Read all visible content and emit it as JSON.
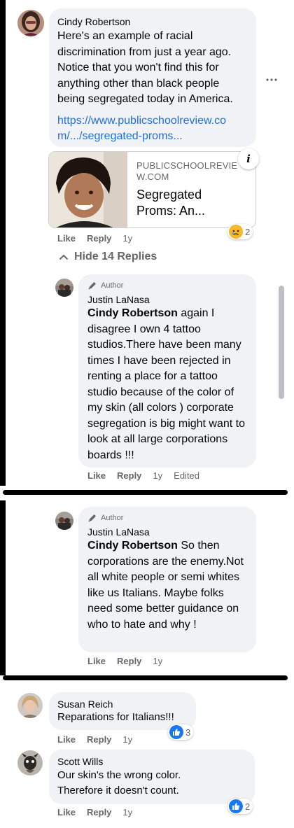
{
  "comment1": {
    "name": "Cindy Robertson",
    "text": "Here's an example of racial discrimination from just a year ago. Notice that you won't find this for anything other than black people being segregated today in America.",
    "link_line1": "https://www.publicschoolreview.co",
    "link_line2": "m/.../segregated-proms...",
    "preview_domain": "PUBLICSCHOOLREVIEW.COM",
    "preview_domain_line1": "PUBLICSCHOOLREVIE",
    "preview_domain_line2": "W.COM",
    "preview_title_line1": "Segregated",
    "preview_title_line2": "Proms: An...",
    "like": "Like",
    "reply": "Reply",
    "time": "1y",
    "reaction_count": "2",
    "more_icon": "more-horizontal-icon",
    "info_icon": "info-icon"
  },
  "hide_replies": "Hide 14 Replies",
  "reply1": {
    "author_tag": "Author",
    "name": "Justin LaNasa",
    "mention": "Cindy Robertson",
    "text": " again I disagree I own 4 tattoo studios.There have been many times I have been rejected in renting a place for a tattoo studio because of the color of my skin (all colors ) corporate segregation is big might want to look at all large corporations boards !!!",
    "like": "Like",
    "reply": "Reply",
    "time": "1y",
    "edited": "Edited"
  },
  "reply2": {
    "author_tag": "Author",
    "name": "Justin LaNasa",
    "mention": "Cindy Robertson",
    "text": " So then corporations are the enemy.Not all white people or semi whites like us Italians. Maybe folks need some better guidance on who to hate and why !",
    "like": "Like",
    "reply": "Reply",
    "time": "1y"
  },
  "comment2": {
    "name": "Susan Reich",
    "text": "Reparations for Italians!!!",
    "like": "Like",
    "reply": "Reply",
    "time": "1y",
    "reaction_count": "3"
  },
  "comment3": {
    "name": "Scott Wills",
    "text_line1": "Our skin's the wrong color.",
    "text_line2": "Therefore it doesn't count.",
    "like": "Like",
    "reply": "Reply",
    "time": "1y",
    "reaction_count": "2"
  },
  "colors": {
    "link": "#216fdb",
    "like_blue": "#1877f2",
    "bubble": "#f0f2f5",
    "meta": "#65676b"
  }
}
